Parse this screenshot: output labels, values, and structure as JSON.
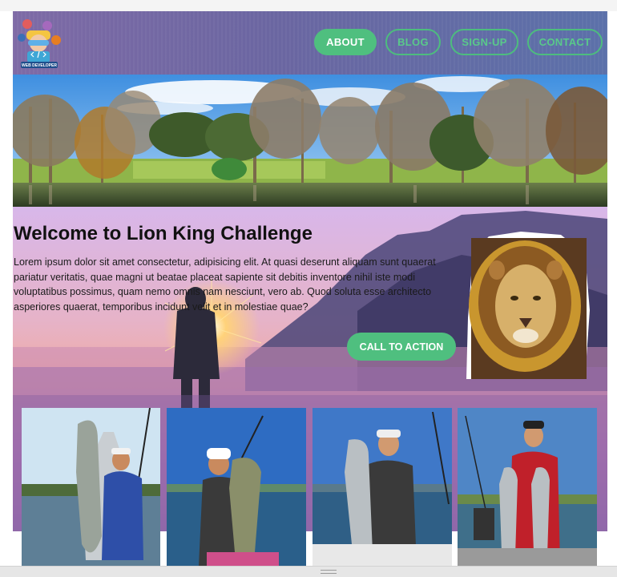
{
  "logo": {
    "icon": "web-developer-logo",
    "caption": "WEB DEVELOPER"
  },
  "nav": {
    "items": [
      {
        "label": "ABOUT",
        "active": true
      },
      {
        "label": "BLOG",
        "active": false
      },
      {
        "label": "SIGN-UP",
        "active": false
      },
      {
        "label": "CONTACT",
        "active": false
      }
    ]
  },
  "hero": {
    "title": "Welcome to Lion King Challenge",
    "text": "Lorem ipsum dolor sit amet consectetur, adipisicing elit. At quasi deserunt aliquam sunt quaerat pariatur veritatis, quae magni ut beatae placeat sapiente sit debitis inventore nihil iste modi voluptatibus possimus, quam nemo omnis nam nesciunt, vero ab. Quod soluta esse architecto asperiores quaerat, temporibus incidunt velit et in molestiae quae?",
    "cta_label": "CALL TO ACTION"
  },
  "colors": {
    "accent_green": "#4fbf7f",
    "header_purple": "#6a66a1"
  }
}
